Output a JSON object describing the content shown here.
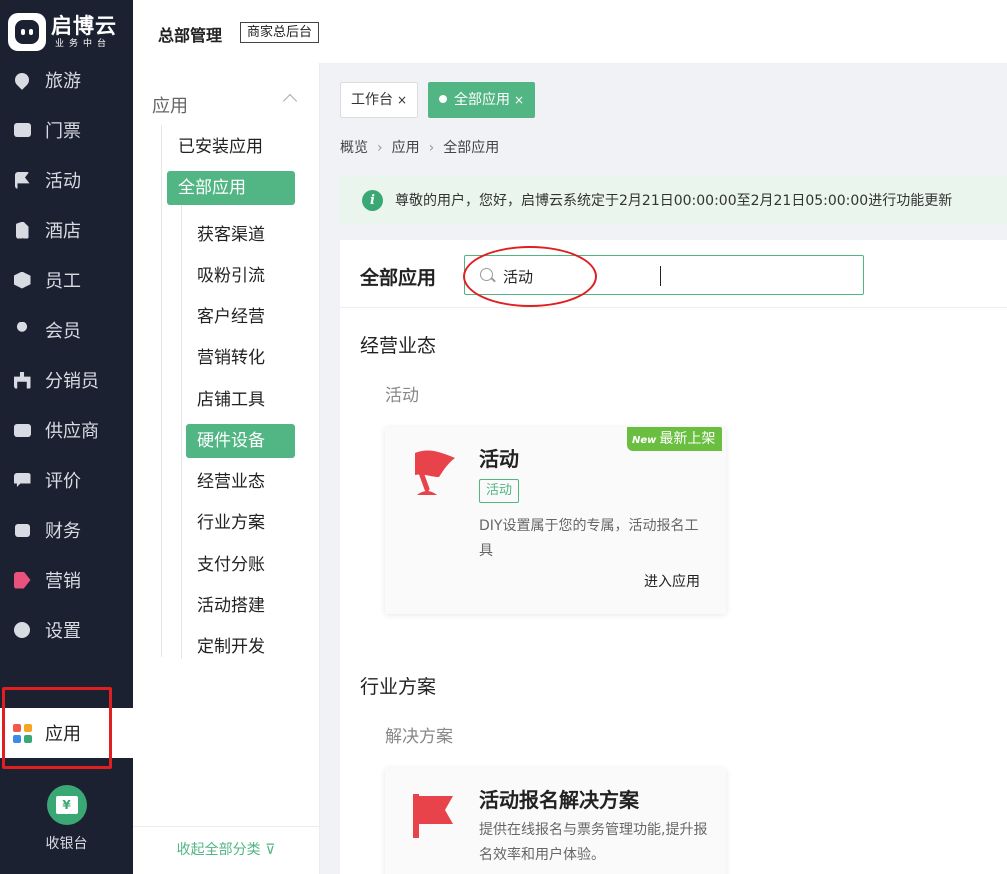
{
  "brand": {
    "name": "启博云",
    "subtitle": "业务中台"
  },
  "nav": {
    "items": [
      {
        "label": "旅游",
        "icon": "map-pin-icon"
      },
      {
        "label": "门票",
        "icon": "ticket-icon"
      },
      {
        "label": "活动",
        "icon": "flag-icon"
      },
      {
        "label": "酒店",
        "icon": "hotel-icon"
      },
      {
        "label": "员工",
        "icon": "employee-icon"
      },
      {
        "label": "会员",
        "icon": "member-icon"
      },
      {
        "label": "分销员",
        "icon": "distributor-icon"
      },
      {
        "label": "供应商",
        "icon": "supplier-icon"
      },
      {
        "label": "评价",
        "icon": "comment-icon"
      },
      {
        "label": "财务",
        "icon": "finance-icon"
      },
      {
        "label": "营销",
        "icon": "marketing-icon"
      },
      {
        "label": "设置",
        "icon": "settings-icon"
      }
    ],
    "active": {
      "label": "应用",
      "icon": "apps-grid-icon"
    },
    "app_grid_colors": [
      "#f05a4a",
      "#f5a623",
      "#3b8beb",
      "#3aa874"
    ],
    "cashier": {
      "label": "收银台",
      "icon": "cashier-icon",
      "glyph": "¥"
    }
  },
  "header": {
    "title": "总部管理",
    "badge": "商家总后台"
  },
  "categories": {
    "heading": "应用",
    "top": [
      "已安装应用",
      "全部应用"
    ],
    "selected_top": "全部应用",
    "sub": [
      "获客渠道",
      "吸粉引流",
      "客户经营",
      "营销转化",
      "店铺工具",
      "硬件设备",
      "经营业态",
      "行业方案",
      "支付分账",
      "活动搭建",
      "定制开发"
    ],
    "selected_sub": "硬件设备",
    "collapse_label": "收起全部分类"
  },
  "tabs": [
    {
      "label": "工作台",
      "close": "×",
      "active": false
    },
    {
      "label": "全部应用",
      "close": "×",
      "active": true
    }
  ],
  "breadcrumb": [
    "概览",
    "应用",
    "全部应用"
  ],
  "notice": {
    "icon": "info-icon",
    "text": "尊敬的用户，您好，启博云系统定于2月21日00:00:00至2月21日05:00:00进行功能更新"
  },
  "main": {
    "title": "全部应用",
    "search": {
      "value": "活动",
      "placeholder": ""
    },
    "sections": [
      {
        "title": "经营业态",
        "subtitle": "活动",
        "card": {
          "name": "活动",
          "icon": "red-flag-icon",
          "tag": "活动",
          "badge": "最新上架",
          "badge_mark": "New",
          "desc": "DIY设置属于您的专属，活动报名工具",
          "action": "进入应用"
        }
      },
      {
        "title": "行业方案",
        "subtitle": "解决方案",
        "card": {
          "name": "活动报名解决方案",
          "icon": "red-banner-icon",
          "desc": "提供在线报名与票务管理功能,提升报名效率和用户体验。"
        }
      }
    ]
  },
  "colors": {
    "accent": "#52b584",
    "sidebar": "#1c2131",
    "highlight": "#e02020",
    "icon_red": "#e8424a"
  }
}
